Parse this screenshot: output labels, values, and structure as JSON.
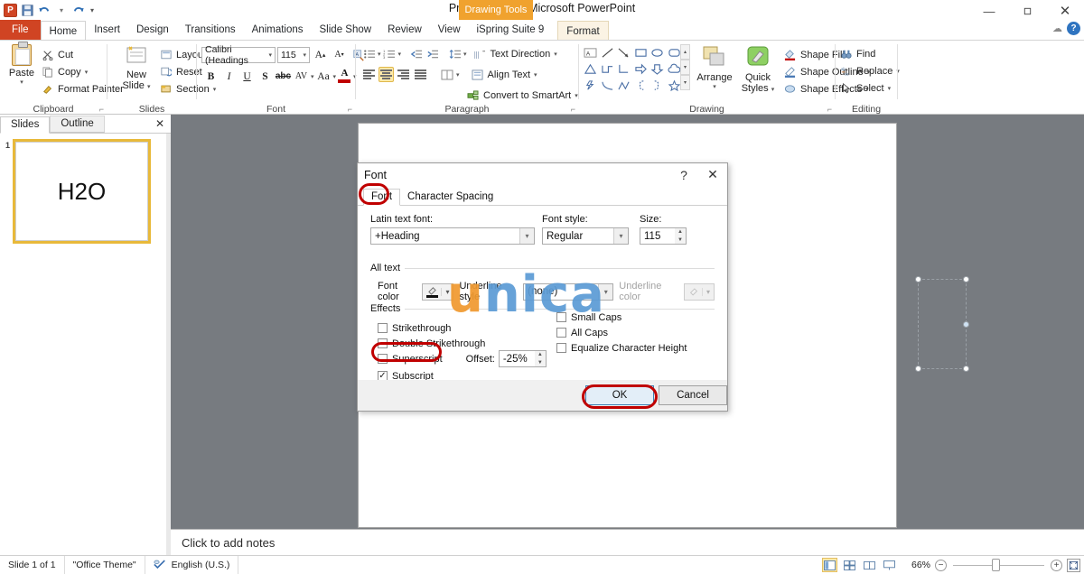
{
  "window": {
    "title": "Presentation1 - Microsoft PowerPoint",
    "contextual_tab_group": "Drawing Tools",
    "minimize": "—",
    "restore": "❐",
    "close": "✕",
    "cloud_icon": "cloud-icon",
    "help_icon": "?"
  },
  "quick_access": {
    "app_logo": "P",
    "items": [
      {
        "name": "save",
        "glyph": "💾"
      },
      {
        "name": "undo",
        "glyph": "↶"
      },
      {
        "name": "undo-dropdown",
        "glyph": "▾"
      },
      {
        "name": "redo",
        "glyph": "↷"
      },
      {
        "name": "customize",
        "glyph": "▾"
      }
    ]
  },
  "tabs": [
    {
      "label": "File",
      "state": "file"
    },
    {
      "label": "Home",
      "state": "active"
    },
    {
      "label": "Insert",
      "state": "normal"
    },
    {
      "label": "Design",
      "state": "normal"
    },
    {
      "label": "Transitions",
      "state": "normal"
    },
    {
      "label": "Animations",
      "state": "normal"
    },
    {
      "label": "Slide Show",
      "state": "normal"
    },
    {
      "label": "Review",
      "state": "normal"
    },
    {
      "label": "View",
      "state": "normal"
    },
    {
      "label": "iSpring Suite 9",
      "state": "normal"
    },
    {
      "label": "Format",
      "state": "contextual"
    }
  ],
  "ribbon": {
    "clipboard": {
      "label": "Clipboard",
      "paste": "Paste",
      "cut": "Cut",
      "copy": "Copy",
      "format_painter": "Format Painter"
    },
    "slides": {
      "label": "Slides",
      "new_slide": "New\nSlide",
      "new_slide_line1": "New",
      "new_slide_line2": "Slide",
      "layout": "Layout",
      "reset": "Reset",
      "section": "Section"
    },
    "font": {
      "label": "Font",
      "font_name": "Calibri (Headings",
      "font_size": "115",
      "grow_font": "A",
      "shrink_font": "A",
      "clear_formatting": "clear-formatting-icon",
      "bold": "B",
      "italic": "I",
      "underline": "U",
      "shadow": "S",
      "strikethrough": "abc",
      "character_spacing": "AV",
      "change_case": "Aa",
      "font_color": "A"
    },
    "paragraph": {
      "label": "Paragraph",
      "bullets": "bullets-icon",
      "numbering": "numbering-icon",
      "decrease_indent": "decrease-indent-icon",
      "increase_indent": "increase-indent-icon",
      "line_spacing": "line-spacing-icon",
      "text_direction": "Text Direction",
      "align_text": "Align Text",
      "convert_to_smartart": "Convert to SmartArt",
      "align_left": "align-left-icon",
      "align_center": "align-center-icon",
      "align_right": "align-right-icon",
      "justify": "justify-icon",
      "columns": "columns-icon"
    },
    "drawing": {
      "label": "Drawing",
      "arrange": "Arrange",
      "quick_styles_line1": "Quick",
      "quick_styles_line2": "Styles",
      "shape_fill": "Shape Fill",
      "shape_outline": "Shape Outline",
      "shape_effects": "Shape Effects"
    },
    "editing": {
      "label": "Editing",
      "find": "Find",
      "replace": "Replace",
      "select": "Select"
    }
  },
  "left_pane": {
    "tab_slides": "Slides",
    "tab_outline": "Outline",
    "close": "✕",
    "slide_number": "1",
    "slide_text": "H2O"
  },
  "notes": {
    "placeholder": "Click to add notes"
  },
  "status_bar": {
    "slide_count": "Slide 1 of 1",
    "theme": "\"Office Theme\"",
    "language": "English (U.S.)",
    "spell_icon": "spellcheck-icon",
    "zoom_level": "66%",
    "zoom_out": "−",
    "zoom_in": "+",
    "fit_to_window": "fit-to-window-icon",
    "views": [
      {
        "name": "normal-view",
        "glyph": "▤",
        "selected": true
      },
      {
        "name": "slide-sorter-view",
        "glyph": "∷",
        "selected": false
      },
      {
        "name": "reading-view",
        "glyph": "▭",
        "selected": false
      },
      {
        "name": "slide-show-view",
        "glyph": "▷",
        "selected": false
      }
    ]
  },
  "font_dialog": {
    "title": "Font",
    "help": "?",
    "close": "✕",
    "tabs": [
      {
        "label": "Font",
        "active": true
      },
      {
        "label": "Character Spacing",
        "active": false
      }
    ],
    "latin_text_font_label": "Latin text font:",
    "latin_text_font_value": "+Heading",
    "font_style_label": "Font style:",
    "font_style_value": "Regular",
    "size_label": "Size:",
    "size_value": "115",
    "all_text_label": "All text",
    "font_color_label": "Font color",
    "underline_style_label": "Underline style",
    "underline_style_value": "(none)",
    "underline_color_label": "Underline color",
    "effects_label": "Effects",
    "effects": [
      {
        "label": "Strikethrough",
        "checked": false,
        "column": "left"
      },
      {
        "label": "Double Strikethrough",
        "checked": false,
        "column": "left"
      },
      {
        "label": "Superscript",
        "checked": false,
        "column": "left"
      },
      {
        "label": "Subscript",
        "checked": true,
        "column": "left",
        "highlighted": true
      },
      {
        "label": "Small Caps",
        "checked": false,
        "column": "right"
      },
      {
        "label": "All Caps",
        "checked": false,
        "column": "right"
      },
      {
        "label": "Equalize Character Height",
        "checked": false,
        "column": "right"
      }
    ],
    "offset_label": "Offset:",
    "offset_value": "-25%",
    "ok": "OK",
    "cancel": "Cancel"
  },
  "watermark": {
    "first": "u",
    "rest": "nica"
  },
  "colors": {
    "accent_orange": "#d04423",
    "contextual_tab": "#f0a22e",
    "highlight_ring": "#c00000",
    "selection_yellow": "#fde9a9",
    "watermark_orange": "#f0992e",
    "watermark_blue": "#5b9bd5",
    "workspace_gray": "#777b80"
  }
}
